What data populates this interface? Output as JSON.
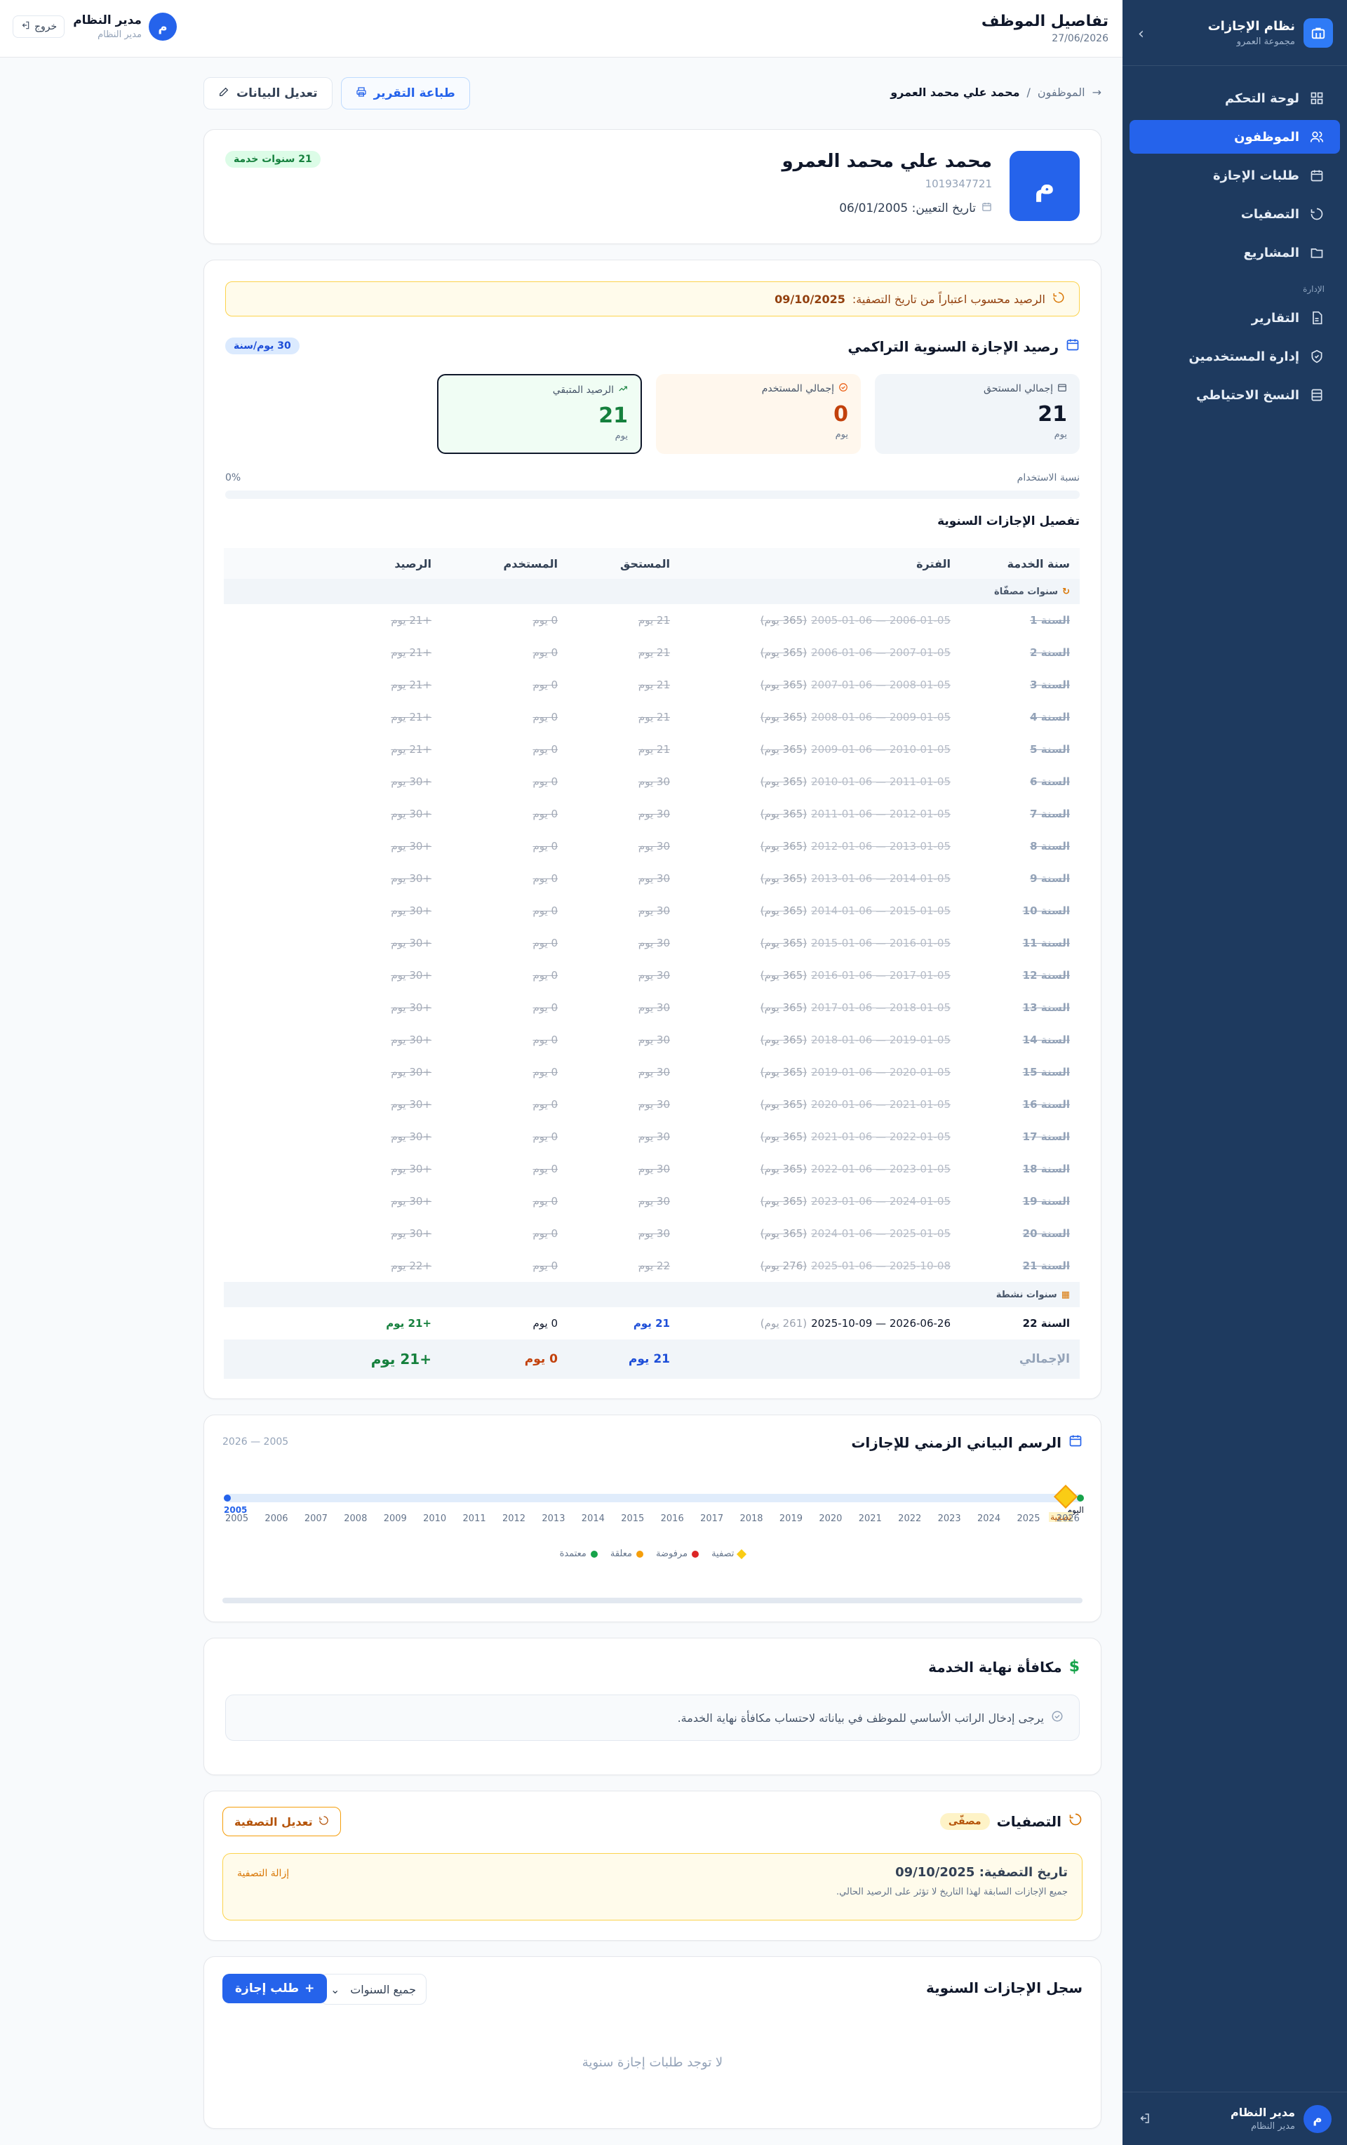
{
  "sidebar": {
    "brand_title": "نظام الإجازات",
    "brand_subtitle": "مجموعة العمرو",
    "items": [
      {
        "label": "لوحة التحكم"
      },
      {
        "label": "الموظفون"
      },
      {
        "label": "طلبات الإجازة"
      },
      {
        "label": "التصفيات"
      },
      {
        "label": "المشاريع"
      }
    ],
    "section_admin": "الإدارة",
    "admin_items": [
      {
        "label": "التقارير"
      },
      {
        "label": "إدارة المستخدمين"
      },
      {
        "label": "النسخ الاحتياطي"
      }
    ],
    "user_name": "مدير النظام",
    "user_role": "مدير النظام",
    "user_initial": "م"
  },
  "topbar": {
    "title": "تفاصيل الموظف",
    "date": "27/06/2026",
    "user_name": "مدير النظام",
    "user_role": "مدير النظام",
    "user_initial": "م",
    "logout": "خروج"
  },
  "breadcrumb": {
    "parent": "الموظفون",
    "sep": "/",
    "current": "محمد علي محمد العمرو"
  },
  "actions": {
    "print": "طباعة التقرير",
    "edit": "تعديل البيانات"
  },
  "profile": {
    "initial": "م",
    "name": "محمد علي محمد العمرو",
    "id": "1019347721",
    "hire_date": "تاريخ التعيين: 06/01/2005",
    "service_badge": "21 سنوات خدمة"
  },
  "balance": {
    "notice_prefix": "الرصيد محسوب اعتباراً من تاريخ التصفية:",
    "notice_date": "09/10/2025",
    "title": "رصيد الإجازة السنوية التراكمي",
    "rate_badge": "30 يوم/سنة",
    "stats": {
      "total_label": "إجمالي المستحق",
      "total_value": "21",
      "total_unit": "يوم",
      "used_label": "إجمالي المستخدم",
      "used_value": "0",
      "used_unit": "يوم",
      "remain_label": "الرصيد المتبقي",
      "remain_value": "21",
      "remain_unit": "يوم"
    },
    "usage_label": "نسبة الاستخدام",
    "usage_percent": "0%",
    "usage_fraction": 0,
    "details_title": "تفصيل الإجازات السنوية",
    "columns": [
      "سنة الخدمة",
      "الفترة",
      "المستحق",
      "المستخدم",
      "الرصيد"
    ],
    "settled_group": "سنوات مصفّاة",
    "active_group": "سنوات نشطة",
    "settled_rows": [
      {
        "year": "السنة 1",
        "period": "2005-01-06 — 2006-01-05",
        "days": "(365 يوم)",
        "entitled": "21 يوم",
        "used": "0 يوم",
        "balance": "+21 يوم"
      },
      {
        "year": "السنة 2",
        "period": "2006-01-06 — 2007-01-05",
        "days": "(365 يوم)",
        "entitled": "21 يوم",
        "used": "0 يوم",
        "balance": "+21 يوم"
      },
      {
        "year": "السنة 3",
        "period": "2007-01-06 — 2008-01-05",
        "days": "(365 يوم)",
        "entitled": "21 يوم",
        "used": "0 يوم",
        "balance": "+21 يوم"
      },
      {
        "year": "السنة 4",
        "period": "2008-01-06 — 2009-01-05",
        "days": "(365 يوم)",
        "entitled": "21 يوم",
        "used": "0 يوم",
        "balance": "+21 يوم"
      },
      {
        "year": "السنة 5",
        "period": "2009-01-06 — 2010-01-05",
        "days": "(365 يوم)",
        "entitled": "21 يوم",
        "used": "0 يوم",
        "balance": "+21 يوم"
      },
      {
        "year": "السنة 6",
        "period": "2010-01-06 — 2011-01-05",
        "days": "(365 يوم)",
        "entitled": "30 يوم",
        "used": "0 يوم",
        "balance": "+30 يوم"
      },
      {
        "year": "السنة 7",
        "period": "2011-01-06 — 2012-01-05",
        "days": "(365 يوم)",
        "entitled": "30 يوم",
        "used": "0 يوم",
        "balance": "+30 يوم"
      },
      {
        "year": "السنة 8",
        "period": "2012-01-06 — 2013-01-05",
        "days": "(365 يوم)",
        "entitled": "30 يوم",
        "used": "0 يوم",
        "balance": "+30 يوم"
      },
      {
        "year": "السنة 9",
        "period": "2013-01-06 — 2014-01-05",
        "days": "(365 يوم)",
        "entitled": "30 يوم",
        "used": "0 يوم",
        "balance": "+30 يوم"
      },
      {
        "year": "السنة 10",
        "period": "2014-01-06 — 2015-01-05",
        "days": "(365 يوم)",
        "entitled": "30 يوم",
        "used": "0 يوم",
        "balance": "+30 يوم"
      },
      {
        "year": "السنة 11",
        "period": "2015-01-06 — 2016-01-05",
        "days": "(365 يوم)",
        "entitled": "30 يوم",
        "used": "0 يوم",
        "balance": "+30 يوم"
      },
      {
        "year": "السنة 12",
        "period": "2016-01-06 — 2017-01-05",
        "days": "(365 يوم)",
        "entitled": "30 يوم",
        "used": "0 يوم",
        "balance": "+30 يوم"
      },
      {
        "year": "السنة 13",
        "period": "2017-01-06 — 2018-01-05",
        "days": "(365 يوم)",
        "entitled": "30 يوم",
        "used": "0 يوم",
        "balance": "+30 يوم"
      },
      {
        "year": "السنة 14",
        "period": "2018-01-06 — 2019-01-05",
        "days": "(365 يوم)",
        "entitled": "30 يوم",
        "used": "0 يوم",
        "balance": "+30 يوم"
      },
      {
        "year": "السنة 15",
        "period": "2019-01-06 — 2020-01-05",
        "days": "(365 يوم)",
        "entitled": "30 يوم",
        "used": "0 يوم",
        "balance": "+30 يوم"
      },
      {
        "year": "السنة 16",
        "period": "2020-01-06 — 2021-01-05",
        "days": "(365 يوم)",
        "entitled": "30 يوم",
        "used": "0 يوم",
        "balance": "+30 يوم"
      },
      {
        "year": "السنة 17",
        "period": "2021-01-06 — 2022-01-05",
        "days": "(365 يوم)",
        "entitled": "30 يوم",
        "used": "0 يوم",
        "balance": "+30 يوم"
      },
      {
        "year": "السنة 18",
        "period": "2022-01-06 — 2023-01-05",
        "days": "(365 يوم)",
        "entitled": "30 يوم",
        "used": "0 يوم",
        "balance": "+30 يوم"
      },
      {
        "year": "السنة 19",
        "period": "2023-01-06 — 2024-01-05",
        "days": "(365 يوم)",
        "entitled": "30 يوم",
        "used": "0 يوم",
        "balance": "+30 يوم"
      },
      {
        "year": "السنة 20",
        "period": "2024-01-06 — 2025-01-05",
        "days": "(365 يوم)",
        "entitled": "30 يوم",
        "used": "0 يوم",
        "balance": "+30 يوم"
      },
      {
        "year": "السنة 21",
        "period": "2025-01-06 — 2025-10-08",
        "days": "(276 يوم)",
        "entitled": "22 يوم",
        "used": "0 يوم",
        "balance": "+22 يوم"
      }
    ],
    "active_rows": [
      {
        "year": "السنة 22",
        "period": "2025-10-09 — 2026-06-26",
        "days": "(261 يوم)",
        "entitled": "21 يوم",
        "used": "0 يوم",
        "balance": "+21 يوم"
      }
    ],
    "total": {
      "label": "الإجمالي",
      "entitled": "21 يوم",
      "used": "0 يوم",
      "balance": "+21 يوم"
    }
  },
  "timeline": {
    "title": "الرسم البياني الزمني للإجازات",
    "range": "2005 — 2026",
    "start_label": "2005",
    "today_label": "اليوم",
    "settlement_label": "تصفية",
    "years": [
      "2005",
      "2006",
      "2007",
      "2008",
      "2009",
      "2010",
      "2011",
      "2012",
      "2013",
      "2014",
      "2015",
      "2016",
      "2017",
      "2018",
      "2019",
      "2020",
      "2021",
      "2022",
      "2023",
      "2024",
      "2025",
      "2026"
    ],
    "legend": [
      {
        "label": "معتمدة",
        "color": "#16a34a"
      },
      {
        "label": "معلقة",
        "color": "#f59e0b"
      },
      {
        "label": "مرفوضة",
        "color": "#dc2626"
      },
      {
        "label": "تصفية",
        "color": "#facc15"
      }
    ]
  },
  "eos": {
    "title": "مكافأة نهاية الخدمة",
    "message": "يرجى إدخال الراتب الأساسي للموظف في بياناته لاحتساب مكافأة نهاية الخدمة."
  },
  "settlements": {
    "title": "التصفيات",
    "badge": "مصفّى",
    "edit_button": "تعديل التصفية",
    "date_line": "تاريخ التصفية: 09/10/2025",
    "note": "جميع الإجازات السابقة لهذا التاريخ لا تؤثر على الرصيد الحالي.",
    "remove": "إزالة التصفية"
  },
  "leave_log": {
    "title": "سجل الإجازات السنوية",
    "filter_value": "جميع السنوات",
    "add_button": "طلب إجازة",
    "empty": "لا توجد طلبات إجازة سنوية"
  },
  "colors": {
    "primary": "#2563eb",
    "sidebar": "#1e3a5f",
    "success": "#15803d",
    "warning": "#b45309"
  }
}
